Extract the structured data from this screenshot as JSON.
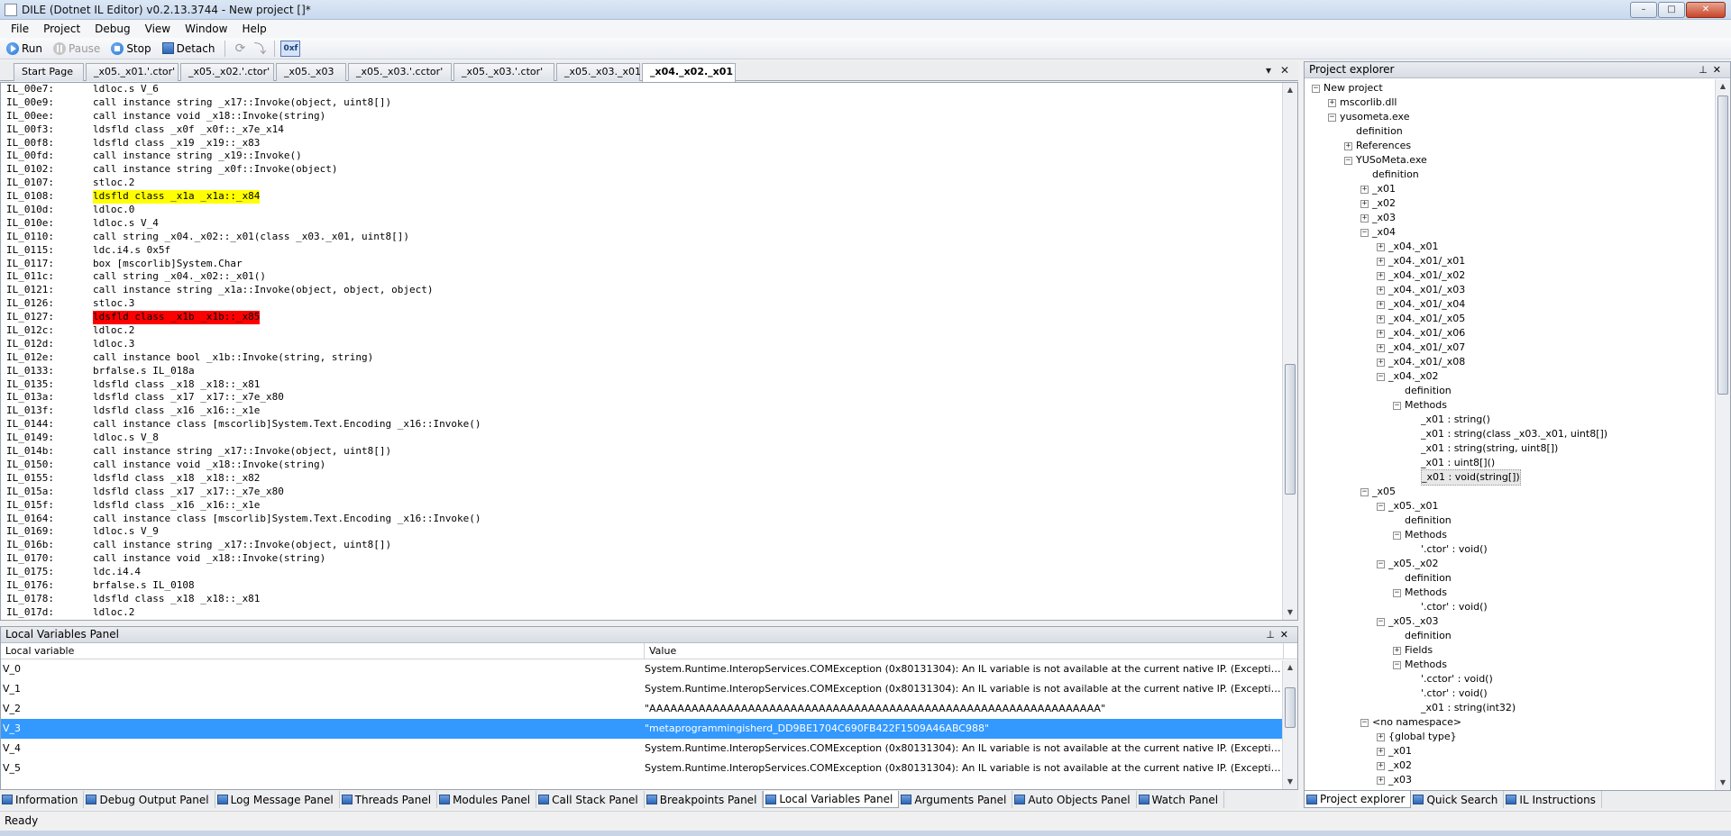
{
  "window": {
    "title": "DILE (Dotnet IL Editor) v0.2.13.3744 - New project []*",
    "minimize": "–",
    "maximize": "□",
    "close": "✕"
  },
  "menu": [
    "File",
    "Project",
    "Debug",
    "View",
    "Window",
    "Help"
  ],
  "toolbar": {
    "run": "Run",
    "pause": "Pause",
    "stop": "Stop",
    "detach": "Detach",
    "hex": "0xf",
    "run_color": "#1e74d6",
    "stop_color": "#1e74d6"
  },
  "doc_tabs": [
    "Start Page",
    "_x05._x01.'.ctor'",
    "_x05._x02.'.ctor'",
    "_x05._x03",
    "_x05._x03.'.cctor'",
    "_x05._x03.'.ctor'",
    "_x05._x03._x01",
    "_x04._x02._x01"
  ],
  "doc_tab_active": 7,
  "code": [
    {
      "o": "IL_00e7:",
      "i": "ldloc.s V_6"
    },
    {
      "o": "IL_00e9:",
      "i": "call instance string _x17::Invoke(object, uint8[])"
    },
    {
      "o": "IL_00ee:",
      "i": "call instance void _x18::Invoke(string)"
    },
    {
      "o": "IL_00f3:",
      "i": "ldsfld class _x0f _x0f::_x7e_x14"
    },
    {
      "o": "IL_00f8:",
      "i": "ldsfld class _x19 _x19::_x83"
    },
    {
      "o": "IL_00fd:",
      "i": "call instance string _x19::Invoke()"
    },
    {
      "o": "IL_0102:",
      "i": "call instance string _x0f::Invoke(object)"
    },
    {
      "o": "IL_0107:",
      "i": "stloc.2"
    },
    {
      "o": "IL_0108:",
      "i": "ldsfld class _x1a _x1a::_x84",
      "h": "yellow"
    },
    {
      "o": "IL_010d:",
      "i": "ldloc.0"
    },
    {
      "o": "IL_010e:",
      "i": "ldloc.s V_4"
    },
    {
      "o": "IL_0110:",
      "i": "call string _x04._x02::_x01(class _x03._x01, uint8[])"
    },
    {
      "o": "IL_0115:",
      "i": "ldc.i4.s 0x5f"
    },
    {
      "o": "IL_0117:",
      "i": "box [mscorlib]System.Char"
    },
    {
      "o": "IL_011c:",
      "i": "call string _x04._x02::_x01()"
    },
    {
      "o": "IL_0121:",
      "i": "call instance string _x1a::Invoke(object, object, object)"
    },
    {
      "o": "IL_0126:",
      "i": "stloc.3"
    },
    {
      "o": "IL_0127:",
      "i": "ldsfld class _x1b _x1b::_x85",
      "h": "red"
    },
    {
      "o": "IL_012c:",
      "i": "ldloc.2"
    },
    {
      "o": "IL_012d:",
      "i": "ldloc.3"
    },
    {
      "o": "IL_012e:",
      "i": "call instance bool _x1b::Invoke(string, string)"
    },
    {
      "o": "IL_0133:",
      "i": "brfalse.s IL_018a"
    },
    {
      "o": "IL_0135:",
      "i": "ldsfld class _x18 _x18::_x81"
    },
    {
      "o": "IL_013a:",
      "i": "ldsfld class _x17 _x17::_x7e_x80"
    },
    {
      "o": "IL_013f:",
      "i": "ldsfld class _x16 _x16::_x1e"
    },
    {
      "o": "IL_0144:",
      "i": "call instance class [mscorlib]System.Text.Encoding _x16::Invoke()"
    },
    {
      "o": "IL_0149:",
      "i": "ldloc.s V_8"
    },
    {
      "o": "IL_014b:",
      "i": "call instance string _x17::Invoke(object, uint8[])"
    },
    {
      "o": "IL_0150:",
      "i": "call instance void _x18::Invoke(string)"
    },
    {
      "o": "IL_0155:",
      "i": "ldsfld class _x18 _x18::_x82"
    },
    {
      "o": "IL_015a:",
      "i": "ldsfld class _x17 _x17::_x7e_x80"
    },
    {
      "o": "IL_015f:",
      "i": "ldsfld class _x16 _x16::_x1e"
    },
    {
      "o": "IL_0164:",
      "i": "call instance class [mscorlib]System.Text.Encoding _x16::Invoke()"
    },
    {
      "o": "IL_0169:",
      "i": "ldloc.s V_9"
    },
    {
      "o": "IL_016b:",
      "i": "call instance string _x17::Invoke(object, uint8[])"
    },
    {
      "o": "IL_0170:",
      "i": "call instance void _x18::Invoke(string)"
    },
    {
      "o": "IL_0175:",
      "i": "ldc.i4.4"
    },
    {
      "o": "IL_0176:",
      "i": "brfalse.s IL_0108"
    },
    {
      "o": "IL_0178:",
      "i": "ldsfld class _x18 _x18::_x81"
    },
    {
      "o": "IL_017d:",
      "i": "ldloc.2"
    }
  ],
  "locals_panel": {
    "title": "Local Variables Panel",
    "col_name": "Local variable",
    "col_value": "Value",
    "rows": [
      {
        "name": "V_0",
        "value": "System.Runtime.InteropServices.COMException (0x80131304): An IL variable is not available at the current native IP. (Exception from HRESULT: 0x80131304)"
      },
      {
        "name": "V_1",
        "value": "System.Runtime.InteropServices.COMException (0x80131304): An IL variable is not available at the current native IP. (Exception from HRESULT: 0x80131304)"
      },
      {
        "name": "V_2",
        "value": "\"AAAAAAAAAAAAAAAAAAAAAAAAAAAAAAAAAAAAAAAAAAAAAAAAAAAAAAAAAAAAAAAA\""
      },
      {
        "name": "V_3",
        "value": "\"metaprogrammingisherd_DD9BE1704C690FB422F1509A46ABC988\"",
        "selected": true
      },
      {
        "name": "V_4",
        "value": "System.Runtime.InteropServices.COMException (0x80131304): An IL variable is not available at the current native IP. (Exception from HRESULT: 0x80131304)"
      },
      {
        "name": "V_5",
        "value": "System.Runtime.InteropServices.COMException (0x80131304): An IL variable is not available at the current native IP. (Exception from HRESULT: 0x80131304)"
      }
    ],
    "selected_color": "#3399ff"
  },
  "bottom_tabs": [
    "Information",
    "Debug Output Panel",
    "Log Message Panel",
    "Threads Panel",
    "Modules Panel",
    "Call Stack Panel",
    "Breakpoints Panel",
    "Local Variables Panel",
    "Arguments Panel",
    "Auto Objects Panel",
    "Watch Panel"
  ],
  "bottom_tab_active": 7,
  "project_explorer": {
    "title": "Project explorer",
    "tree": [
      {
        "d": 0,
        "e": "-",
        "t": "New project"
      },
      {
        "d": 1,
        "e": "+",
        "t": "mscorlib.dll"
      },
      {
        "d": 1,
        "e": "-",
        "t": "yusometa.exe"
      },
      {
        "d": 2,
        "e": "",
        "t": "definition"
      },
      {
        "d": 2,
        "e": "+",
        "t": "References"
      },
      {
        "d": 2,
        "e": "-",
        "t": "YUSoMeta.exe"
      },
      {
        "d": 3,
        "e": "",
        "t": "definition"
      },
      {
        "d": 3,
        "e": "+",
        "t": "_x01"
      },
      {
        "d": 3,
        "e": "+",
        "t": "_x02"
      },
      {
        "d": 3,
        "e": "+",
        "t": "_x03"
      },
      {
        "d": 3,
        "e": "-",
        "t": "_x04"
      },
      {
        "d": 4,
        "e": "+",
        "t": "_x04._x01"
      },
      {
        "d": 4,
        "e": "+",
        "t": "_x04._x01/_x01"
      },
      {
        "d": 4,
        "e": "+",
        "t": "_x04._x01/_x02"
      },
      {
        "d": 4,
        "e": "+",
        "t": "_x04._x01/_x03"
      },
      {
        "d": 4,
        "e": "+",
        "t": "_x04._x01/_x04"
      },
      {
        "d": 4,
        "e": "+",
        "t": "_x04._x01/_x05"
      },
      {
        "d": 4,
        "e": "+",
        "t": "_x04._x01/_x06"
      },
      {
        "d": 4,
        "e": "+",
        "t": "_x04._x01/_x07"
      },
      {
        "d": 4,
        "e": "+",
        "t": "_x04._x01/_x08"
      },
      {
        "d": 4,
        "e": "-",
        "t": "_x04._x02"
      },
      {
        "d": 5,
        "e": "",
        "t": "definition"
      },
      {
        "d": 5,
        "e": "-",
        "t": "Methods"
      },
      {
        "d": 6,
        "e": "",
        "t": "_x01 : string()"
      },
      {
        "d": 6,
        "e": "",
        "t": "_x01 : string(class _x03._x01, uint8[])"
      },
      {
        "d": 6,
        "e": "",
        "t": "_x01 : string(string, uint8[])"
      },
      {
        "d": 6,
        "e": "",
        "t": "_x01 : uint8[]()"
      },
      {
        "d": 6,
        "e": "",
        "t": "_x01 : void(string[])",
        "sel": true
      },
      {
        "d": 3,
        "e": "-",
        "t": "_x05"
      },
      {
        "d": 4,
        "e": "-",
        "t": "_x05._x01"
      },
      {
        "d": 5,
        "e": "",
        "t": "definition"
      },
      {
        "d": 5,
        "e": "-",
        "t": "Methods"
      },
      {
        "d": 6,
        "e": "",
        "t": "'.ctor' : void()"
      },
      {
        "d": 4,
        "e": "-",
        "t": "_x05._x02"
      },
      {
        "d": 5,
        "e": "",
        "t": "definition"
      },
      {
        "d": 5,
        "e": "-",
        "t": "Methods"
      },
      {
        "d": 6,
        "e": "",
        "t": "'.ctor' : void()"
      },
      {
        "d": 4,
        "e": "-",
        "t": "_x05._x03"
      },
      {
        "d": 5,
        "e": "",
        "t": "definition"
      },
      {
        "d": 5,
        "e": "+",
        "t": "Fields"
      },
      {
        "d": 5,
        "e": "-",
        "t": "Methods"
      },
      {
        "d": 6,
        "e": "",
        "t": "'.cctor' : void()"
      },
      {
        "d": 6,
        "e": "",
        "t": "'.ctor' : void()"
      },
      {
        "d": 6,
        "e": "",
        "t": "_x01 : string(int32)"
      },
      {
        "d": 3,
        "e": "-",
        "t": "<no namespace>"
      },
      {
        "d": 4,
        "e": "+",
        "t": "{global type}"
      },
      {
        "d": 4,
        "e": "+",
        "t": "_x01"
      },
      {
        "d": 4,
        "e": "+",
        "t": "_x02"
      },
      {
        "d": 4,
        "e": "+",
        "t": "_x03"
      }
    ],
    "tabs": [
      "Project explorer",
      "Quick Search",
      "IL Instructions"
    ],
    "tab_active": 0
  },
  "status": "Ready"
}
